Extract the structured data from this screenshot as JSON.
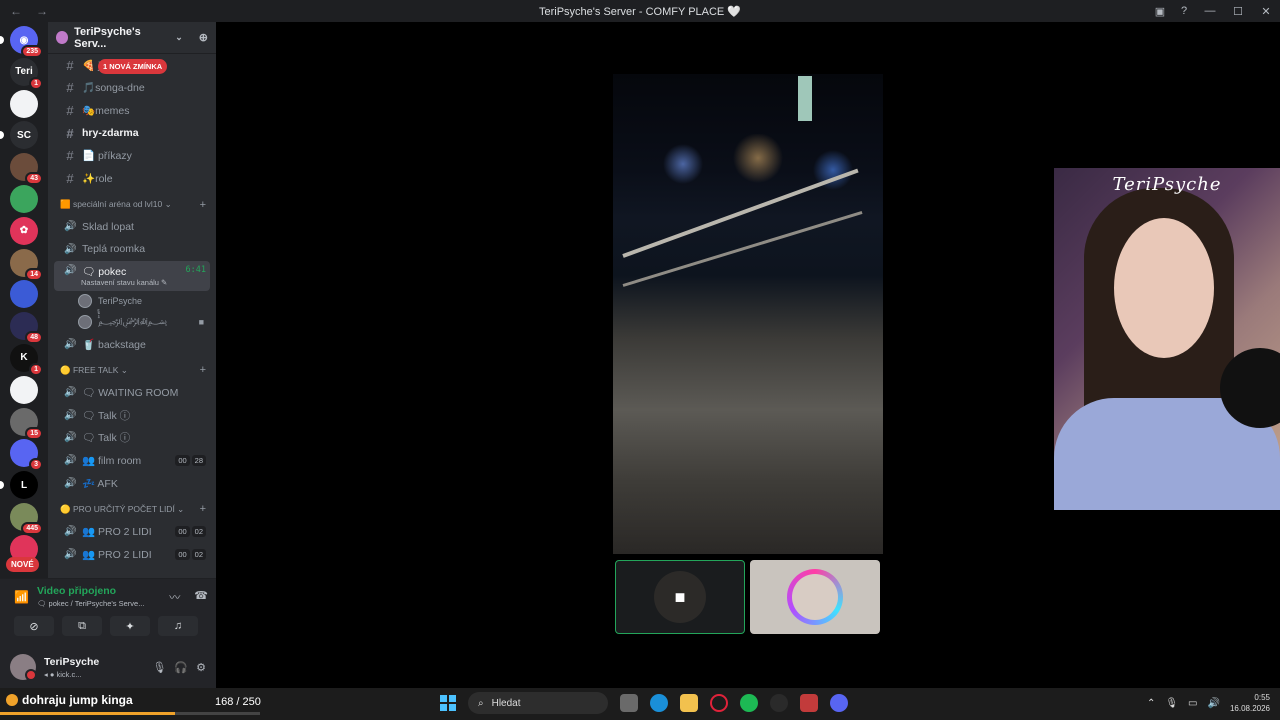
{
  "window": {
    "title": "TeriPsyche's Server - COMFY PLACE 🤍",
    "back": "←",
    "forward": "→",
    "inbox": "▣",
    "help": "?",
    "minimize": "—",
    "maximize": "☐",
    "close": "✕"
  },
  "guilds": [
    {
      "label": "◉",
      "badge": "235",
      "color": "#5865f2",
      "pill": true
    },
    {
      "label": "Teri",
      "badge": "1",
      "color": "#2b2d31"
    },
    {
      "label": "",
      "badge": "",
      "color": "#f2f3f5"
    },
    {
      "label": "SC",
      "badge": "",
      "color": "#2b2d31",
      "pill": true
    },
    {
      "label": "",
      "badge": "43",
      "color": "#6b4c3b"
    },
    {
      "label": "",
      "badge": "",
      "color": "#3ba55d"
    },
    {
      "label": "✿",
      "badge": "",
      "color": "#e0345a"
    },
    {
      "label": "",
      "badge": "14",
      "color": "#8a6a4a"
    },
    {
      "label": "",
      "badge": "",
      "color": "#3b5bd6"
    },
    {
      "label": "",
      "badge": "48",
      "color": "#2c2c54"
    },
    {
      "label": "K",
      "badge": "1",
      "color": "#111"
    },
    {
      "label": "",
      "badge": "",
      "color": "#f2f3f5"
    },
    {
      "label": "",
      "badge": "15",
      "color": "#6a6a6a"
    },
    {
      "label": "",
      "badge": "3",
      "color": "#5865f2"
    },
    {
      "label": "L",
      "badge": "",
      "color": "#000",
      "pill": true
    },
    {
      "label": "",
      "badge": "445",
      "color": "#7a8a5a"
    },
    {
      "label": "",
      "badge": "",
      "color": "#e0345a"
    }
  ],
  "guild_new": "NOVÉ",
  "server": {
    "name": "TeriPsyche's Serv...",
    "chevron": "⌄",
    "add_people": "⊕"
  },
  "channels_top": [
    {
      "name": "🍕 ji",
      "icon": "#",
      "bold": false
    },
    {
      "name": "🎵songa-dne",
      "icon": "#",
      "bold": false
    },
    {
      "name": "🎭memes",
      "icon": "#",
      "bold": false
    },
    {
      "name": "hry-zdarma",
      "icon": "#",
      "bold": true
    },
    {
      "name": "📄 příkazy",
      "icon": "#",
      "bold": false
    },
    {
      "name": "✨role",
      "icon": "#",
      "bold": false
    }
  ],
  "mention_badge": "1 NOVÁ ZMÍNKA",
  "category1": {
    "name": "🟧 speciální aréna od lvl10 ⌄",
    "plus": "+"
  },
  "channels_voice1": [
    {
      "name": "Sklad lopat",
      "icon": "🔊"
    },
    {
      "name": "Teplá roomka",
      "icon": "🔊"
    }
  ],
  "active_channel": {
    "name": "🗨 pokec",
    "time": "6:41",
    "sub": "Nastavení stavu kanálu ✎",
    "icon": "🔊"
  },
  "voice_users": [
    {
      "name": "TeriPsyche",
      "cam": ""
    },
    {
      "name": "﷽ٌٌّ٘ٔ",
      "cam": "■"
    }
  ],
  "backstage": {
    "name": "🥤 backstage",
    "icon": "🔊"
  },
  "category2": {
    "name": "🟡 FREE TALK ⌄",
    "plus": "+"
  },
  "channels_voice2": [
    {
      "name": "🗨 WAITING ROOM",
      "icon": "🔊",
      "counts": []
    },
    {
      "name": "🗨 Talk ⓘ",
      "icon": "🔊",
      "counts": []
    },
    {
      "name": "🗨 Talk ⓘ",
      "icon": "🔊",
      "counts": []
    },
    {
      "name": "👥 film room",
      "icon": "🔊",
      "counts": [
        "00",
        "28"
      ]
    },
    {
      "name": "💤 AFK",
      "icon": "🔊",
      "counts": []
    }
  ],
  "category3": {
    "name": "🟡 PRO URČITÝ POČET LIDÍ ⌄",
    "plus": "+"
  },
  "channels_voice3": [
    {
      "name": "👥 PRO 2 LIDI",
      "icon": "🔊",
      "counts": [
        "00",
        "02"
      ]
    },
    {
      "name": "👥 PRO 2 LIDI",
      "icon": "🔊",
      "counts": [
        "00",
        "02"
      ]
    }
  ],
  "voice_panel": {
    "status": "Video připojeno",
    "location": "🗨 pokec / TeriPsyche's Serve...",
    "signal": "📶",
    "noise": "〰",
    "disconnect": "☎",
    "btn_camera": "⊘",
    "btn_screen": "⧉",
    "btn_activity": "✦",
    "btn_soundboard": "♫"
  },
  "user_panel": {
    "name": "TeriPsyche",
    "status": "◂ ● kick.c...",
    "mic": "🎙",
    "headset": "🎧",
    "settings": "⚙"
  },
  "stage": {
    "cam_label": "TeriPsyche",
    "tile_a_icon": "■"
  },
  "taskbar": {
    "goal_text": "dohraju jump kinga",
    "goal_count": "168 / 250",
    "goal_progress": 0.672,
    "search": "Hledat",
    "time": "0:55",
    "date": "16.08.2026"
  }
}
